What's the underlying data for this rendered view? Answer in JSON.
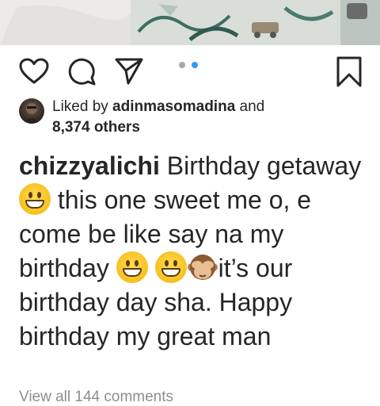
{
  "post": {
    "carousel": {
      "total": 2,
      "active": 2,
      "active_color": "#3897f0",
      "inactive_color": "#a8a8a8"
    },
    "actions": {
      "like_icon": "heart-icon",
      "comment_icon": "comment-bubble-icon",
      "share_icon": "paper-plane-icon",
      "save_icon": "bookmark-icon"
    },
    "likes": {
      "prefix": "Liked by ",
      "user": "adinmasomadina",
      "conjunction": " and",
      "others": "8,374 others"
    },
    "caption": {
      "username": "chizzyalichi",
      "line1": " Birthday getaway ",
      "line2": " this one sweet me o, e come be like say na my birthday ",
      "line3": "it’s our birthday day sha. Happy birthday my great man"
    },
    "comments_link": "View all 144 comments"
  }
}
